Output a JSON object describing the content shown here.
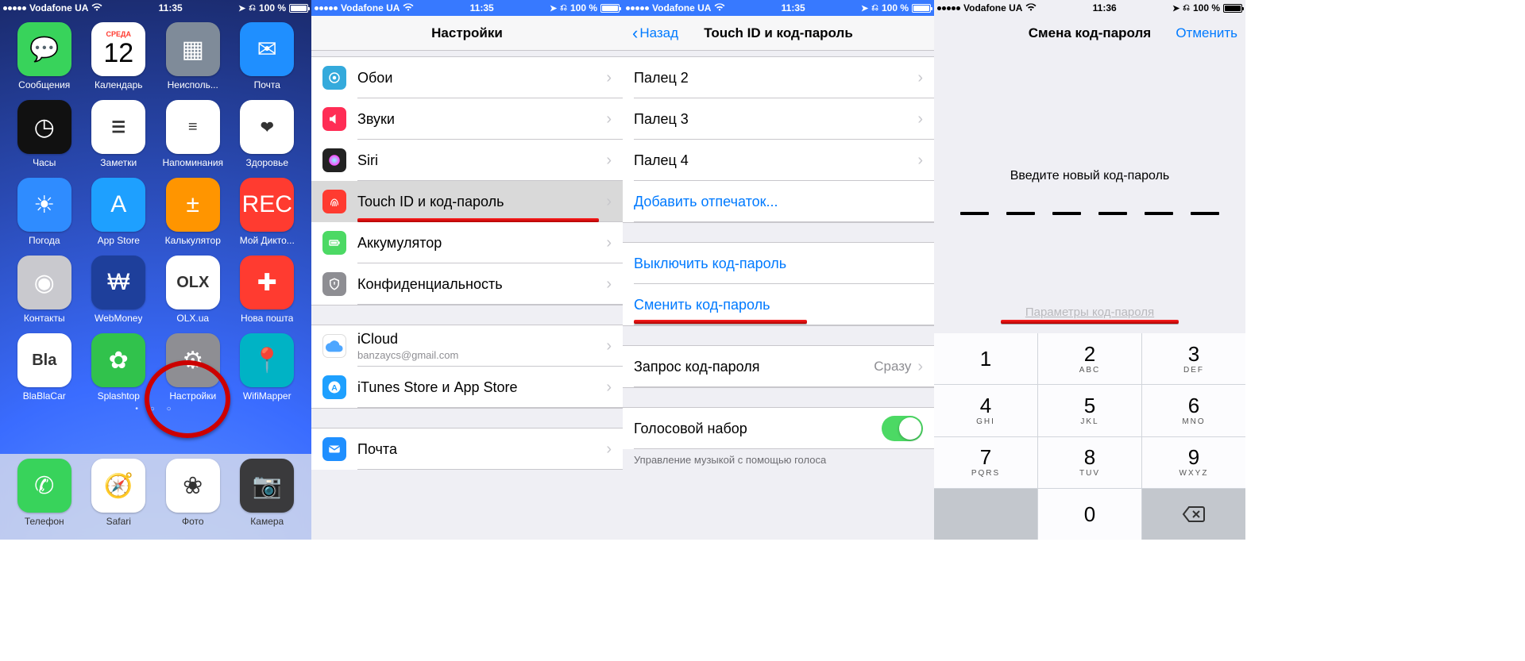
{
  "status": {
    "carrier": "Vodafone UA",
    "time_a": "11:35",
    "time_b": "11:36",
    "battery": "100 %"
  },
  "home": {
    "apps": [
      {
        "label": "Сообщения",
        "bg": "#38d35b",
        "glyph": "💬"
      },
      {
        "label": "Календарь",
        "bg": "#ffffff",
        "glyph": "12",
        "day": "СРЕДА"
      },
      {
        "label": "Неисполь...",
        "bg": "#7f8b99",
        "glyph": "▦"
      },
      {
        "label": "Почта",
        "bg": "#1f8fff",
        "glyph": "✉"
      },
      {
        "label": "Часы",
        "bg": "#111",
        "glyph": "◷"
      },
      {
        "label": "Заметки",
        "bg": "#ffffff",
        "glyph": "☰"
      },
      {
        "label": "Напоминания",
        "bg": "#ffffff",
        "glyph": "≡"
      },
      {
        "label": "Здоровье",
        "bg": "#ffffff",
        "glyph": "❤"
      },
      {
        "label": "Погода",
        "bg": "#2f8cff",
        "glyph": "☀"
      },
      {
        "label": "App Store",
        "bg": "#1ea0ff",
        "glyph": "A"
      },
      {
        "label": "Калькулятор",
        "bg": "#ff9500",
        "glyph": "±"
      },
      {
        "label": "Мой Дикто...",
        "bg": "#ff3b30",
        "glyph": "REC"
      },
      {
        "label": "Контакты",
        "bg": "#c9c9ce",
        "glyph": "◉"
      },
      {
        "label": "WebMoney",
        "bg": "#1e3f9b",
        "glyph": "₩"
      },
      {
        "label": "OLX.ua",
        "bg": "#ffffff",
        "glyph": "OLX"
      },
      {
        "label": "Нова пошта",
        "bg": "#ff3b30",
        "glyph": "✚"
      },
      {
        "label": "BlaBlaCar",
        "bg": "#ffffff",
        "glyph": "Bla"
      },
      {
        "label": "Splashtop",
        "bg": "#31c24c",
        "glyph": "✿"
      },
      {
        "label": "Настройки",
        "bg": "#8e8e93",
        "glyph": "⚙"
      },
      {
        "label": "WifiMapper",
        "bg": "#00b3c5",
        "glyph": "📍"
      }
    ],
    "dock": [
      {
        "label": "Телефон",
        "bg": "#38d35b",
        "glyph": "✆"
      },
      {
        "label": "Safari",
        "bg": "#ffffff",
        "glyph": "🧭"
      },
      {
        "label": "Фото",
        "bg": "#ffffff",
        "glyph": "❀"
      },
      {
        "label": "Камера",
        "bg": "#3a3a3c",
        "glyph": "📷"
      }
    ]
  },
  "settings": {
    "title": "Настройки",
    "rows": [
      {
        "icon": "wallpaper",
        "bg": "#34aadc",
        "label": "Обои"
      },
      {
        "icon": "sounds",
        "bg": "#ff2d55",
        "label": "Звуки"
      },
      {
        "icon": "siri",
        "bg": "#222",
        "label": "Siri"
      },
      {
        "icon": "touchid",
        "bg": "#ff3b30",
        "label": "Touch ID и код-пароль",
        "hl": true
      },
      {
        "icon": "battery",
        "bg": "#4cd964",
        "label": "Аккумулятор"
      },
      {
        "icon": "privacy",
        "bg": "#8e8e93",
        "label": "Конфиденциальность"
      }
    ],
    "rows2": [
      {
        "icon": "icloud",
        "bg": "#ffffff",
        "label": "iCloud",
        "sub": "banzaycs@gmail.com"
      },
      {
        "icon": "appstore",
        "bg": "#1ea0ff",
        "label": "iTunes Store и App Store"
      }
    ],
    "rows3": [
      {
        "icon": "mail",
        "bg": "#1f8fff",
        "label": "Почта"
      }
    ]
  },
  "touchid": {
    "back": "Назад",
    "title": "Touch ID и код-пароль",
    "fingers": [
      "Палец 2",
      "Палец 3",
      "Палец 4"
    ],
    "add_finger": "Добавить отпечаток...",
    "turn_off": "Выключить код-пароль",
    "change": "Сменить код-пароль",
    "require_label": "Запрос код-пароля",
    "require_value": "Сразу",
    "voice_label": "Голосовой набор",
    "voice_note": "Управление музыкой с помощью голоса"
  },
  "passcode": {
    "title": "Смена код-пароля",
    "cancel": "Отменить",
    "prompt": "Введите новый код-пароль",
    "options": "Параметры код-пароля",
    "keys": [
      {
        "n": "1",
        "l": ""
      },
      {
        "n": "2",
        "l": "ABC"
      },
      {
        "n": "3",
        "l": "DEF"
      },
      {
        "n": "4",
        "l": "GHI"
      },
      {
        "n": "5",
        "l": "JKL"
      },
      {
        "n": "6",
        "l": "MNO"
      },
      {
        "n": "7",
        "l": "PQRS"
      },
      {
        "n": "8",
        "l": "TUV"
      },
      {
        "n": "9",
        "l": "WXYZ"
      },
      {
        "n": "",
        "l": "",
        "blank": true
      },
      {
        "n": "0",
        "l": ""
      },
      {
        "n": "",
        "l": "",
        "del": true
      }
    ]
  }
}
